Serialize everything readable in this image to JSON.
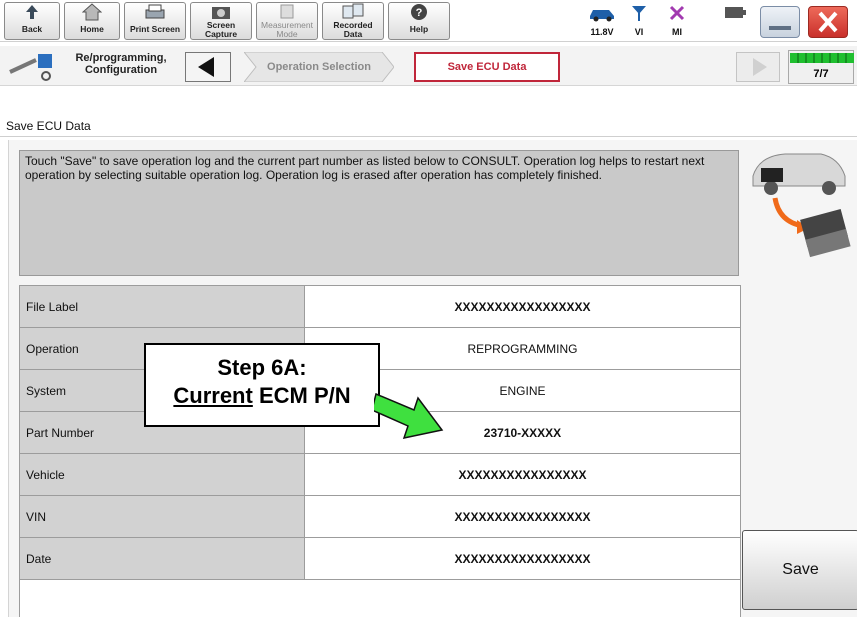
{
  "toolbar": {
    "back": "Back",
    "home": "Home",
    "print_screen": "Print Screen",
    "screen_capture": "Screen\nCapture",
    "measurement_mode": "Measurement\nMode",
    "recorded_data": "Recorded\nData",
    "help": "Help",
    "voltage": "11.8V",
    "vi": "VI",
    "mi": "MI"
  },
  "breadcrumb": {
    "title": "Re/programming,\nConfiguration",
    "step1": "Operation Selection",
    "step2": "Save ECU Data",
    "counter": "7/7"
  },
  "section_header": "Save ECU Data",
  "message": "Touch \"Save\" to save operation log and the current part number as listed below to CONSULT. Operation log helps to restart next operation by selecting suitable operation log. Operation log is erased after operation has completely finished.",
  "table": {
    "rows": [
      {
        "label": "File Label",
        "value": "XXXXXXXXXXXXXXXXX"
      },
      {
        "label": "Operation",
        "value": "REPROGRAMMING"
      },
      {
        "label": "System",
        "value": "ENGINE"
      },
      {
        "label": "Part Number",
        "value": "23710-XXXXX"
      },
      {
        "label": "Vehicle",
        "value": "XXXXXXXXXXXXXXXX"
      },
      {
        "label": "VIN",
        "value": "XXXXXXXXXXXXXXXXX"
      },
      {
        "label": "Date",
        "value": "XXXXXXXXXXXXXXXXX"
      }
    ]
  },
  "save_button": "Save",
  "annotation": {
    "line1": "Step 6A:",
    "line2_underlined": "Current",
    "line2_rest": " ECM P/N"
  },
  "colors": {
    "accent_red": "#c0263a",
    "arrow_green": "#3fe03f",
    "close_red": "#d9302b"
  }
}
